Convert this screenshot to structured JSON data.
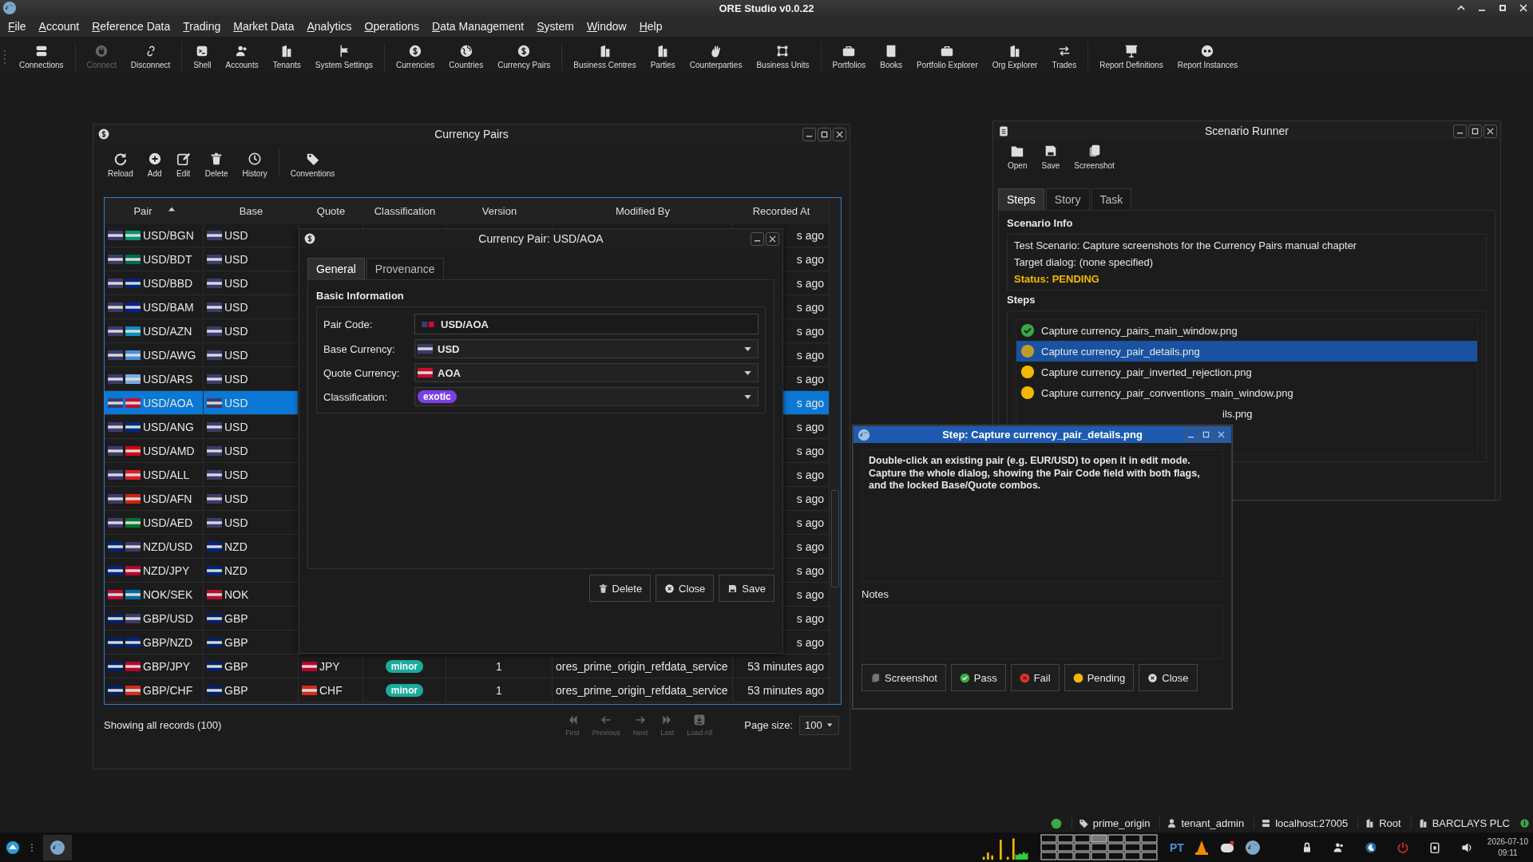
{
  "app": {
    "title": "ORE Studio v0.0.22"
  },
  "menu": [
    "File",
    "Account",
    "Reference Data",
    "Trading",
    "Market Data",
    "Analytics",
    "Operations",
    "Data Management",
    "System",
    "Window",
    "Help"
  ],
  "toolbar": [
    {
      "label": "Connections",
      "disabled": false
    },
    {
      "label": "Connect",
      "disabled": true
    },
    {
      "label": "Disconnect",
      "disabled": false
    },
    {
      "label": "Shell",
      "disabled": false
    },
    {
      "label": "Accounts",
      "disabled": false
    },
    {
      "label": "Tenants",
      "disabled": false
    },
    {
      "label": "System Settings",
      "disabled": false
    },
    {
      "label": "Currencies",
      "disabled": false
    },
    {
      "label": "Countries",
      "disabled": false
    },
    {
      "label": "Currency Pairs",
      "disabled": false
    },
    {
      "label": "Business Centres",
      "disabled": false
    },
    {
      "label": "Parties",
      "disabled": false
    },
    {
      "label": "Counterparties",
      "disabled": false
    },
    {
      "label": "Business Units",
      "disabled": false
    },
    {
      "label": "Portfolios",
      "disabled": false
    },
    {
      "label": "Books",
      "disabled": false
    },
    {
      "label": "Portfolio Explorer",
      "disabled": false
    },
    {
      "label": "Org Explorer",
      "disabled": false
    },
    {
      "label": "Trades",
      "disabled": false
    },
    {
      "label": "Report Definitions",
      "disabled": false
    },
    {
      "label": "Report Instances",
      "disabled": false
    }
  ],
  "currency_pairs": {
    "title": "Currency Pairs",
    "toolbar": [
      "Reload",
      "Add",
      "Edit",
      "Delete",
      "History",
      "Conventions"
    ],
    "columns": [
      {
        "label": "Pair",
        "sorted": true
      },
      {
        "label": "Base",
        "sorted": false
      },
      {
        "label": "Quote",
        "sorted": false
      },
      {
        "label": "Classification",
        "sorted": false
      },
      {
        "label": "Version",
        "sorted": false
      },
      {
        "label": "Modified By",
        "sorted": false
      },
      {
        "label": "Recorded At",
        "sorted": false
      }
    ],
    "rows": [
      {
        "pair": "USD/BGN",
        "pair_flags": [
          {
            "color": "#3c3b6e"
          },
          {
            "color": "#00966e"
          }
        ],
        "base": "USD",
        "base_flag": {
          "color": "#3c3b6e"
        },
        "recorded_at": "s ago",
        "selected": false
      },
      {
        "pair": "USD/BDT",
        "pair_flags": [
          {
            "color": "#3c3b6e"
          },
          {
            "color": "#006a4e"
          }
        ],
        "base": "USD",
        "base_flag": {
          "color": "#3c3b6e"
        },
        "recorded_at": "s ago",
        "selected": false
      },
      {
        "pair": "USD/BBD",
        "pair_flags": [
          {
            "color": "#3c3b6e"
          },
          {
            "color": "#00267f"
          }
        ],
        "base": "USD",
        "base_flag": {
          "color": "#3c3b6e"
        },
        "recorded_at": "s ago",
        "selected": false
      },
      {
        "pair": "USD/BAM",
        "pair_flags": [
          {
            "color": "#3c3b6e"
          },
          {
            "color": "#002395"
          }
        ],
        "base": "USD",
        "base_flag": {
          "color": "#3c3b6e"
        },
        "recorded_at": "s ago",
        "selected": false
      },
      {
        "pair": "USD/AZN",
        "pair_flags": [
          {
            "color": "#3c3b6e"
          },
          {
            "color": "#0092bc"
          }
        ],
        "base": "USD",
        "base_flag": {
          "color": "#3c3b6e"
        },
        "recorded_at": "s ago",
        "selected": false
      },
      {
        "pair": "USD/AWG",
        "pair_flags": [
          {
            "color": "#3c3b6e"
          },
          {
            "color": "#418fde"
          }
        ],
        "base": "USD",
        "base_flag": {
          "color": "#3c3b6e"
        },
        "recorded_at": "s ago",
        "selected": false
      },
      {
        "pair": "USD/ARS",
        "pair_flags": [
          {
            "color": "#3c3b6e"
          },
          {
            "color": "#74acdf"
          }
        ],
        "base": "USD",
        "base_flag": {
          "color": "#3c3b6e"
        },
        "recorded_at": "s ago",
        "selected": false
      },
      {
        "pair": "USD/AOA",
        "pair_flags": [
          {
            "color": "#3c3b6e"
          },
          {
            "color": "#cc092f"
          }
        ],
        "base": "USD",
        "base_flag": {
          "color": "#3c3b6e"
        },
        "recorded_at": "s ago",
        "selected": true
      },
      {
        "pair": "USD/ANG",
        "pair_flags": [
          {
            "color": "#3c3b6e"
          },
          {
            "color": "#002b7f"
          }
        ],
        "base": "USD",
        "base_flag": {
          "color": "#3c3b6e"
        },
        "recorded_at": "s ago",
        "selected": false
      },
      {
        "pair": "USD/AMD",
        "pair_flags": [
          {
            "color": "#3c3b6e"
          },
          {
            "color": "#d90012"
          }
        ],
        "base": "USD",
        "base_flag": {
          "color": "#3c3b6e"
        },
        "recorded_at": "s ago",
        "selected": false
      },
      {
        "pair": "USD/ALL",
        "pair_flags": [
          {
            "color": "#3c3b6e"
          },
          {
            "color": "#e41e20"
          }
        ],
        "base": "USD",
        "base_flag": {
          "color": "#3c3b6e"
        },
        "recorded_at": "s ago",
        "selected": false
      },
      {
        "pair": "USD/AFN",
        "pair_flags": [
          {
            "color": "#3c3b6e"
          },
          {
            "color": "#d32011"
          }
        ],
        "base": "USD",
        "base_flag": {
          "color": "#3c3b6e"
        },
        "recorded_at": "s ago",
        "selected": false
      },
      {
        "pair": "USD/AED",
        "pair_flags": [
          {
            "color": "#3c3b6e"
          },
          {
            "color": "#00732f"
          }
        ],
        "base": "USD",
        "base_flag": {
          "color": "#3c3b6e"
        },
        "recorded_at": "s ago",
        "selected": false
      },
      {
        "pair": "NZD/USD",
        "pair_flags": [
          {
            "color": "#00247d"
          },
          {
            "color": "#3c3b6e"
          }
        ],
        "base": "NZD",
        "base_flag": {
          "color": "#00247d"
        },
        "recorded_at": "s ago",
        "selected": false
      },
      {
        "pair": "NZD/JPY",
        "pair_flags": [
          {
            "color": "#00247d"
          },
          {
            "color": "#bc002d"
          }
        ],
        "base": "NZD",
        "base_flag": {
          "color": "#00247d"
        },
        "recorded_at": "s ago",
        "selected": false
      },
      {
        "pair": "NOK/SEK",
        "pair_flags": [
          {
            "color": "#ba0c2f"
          },
          {
            "color": "#006aa7"
          }
        ],
        "base": "NOK",
        "base_flag": {
          "color": "#ba0c2f"
        },
        "recorded_at": "s ago",
        "selected": false
      },
      {
        "pair": "GBP/USD",
        "pair_flags": [
          {
            "color": "#012169"
          },
          {
            "color": "#3c3b6e"
          }
        ],
        "base": "GBP",
        "base_flag": {
          "color": "#012169"
        },
        "recorded_at": "s ago",
        "selected": false
      },
      {
        "pair": "GBP/NZD",
        "pair_flags": [
          {
            "color": "#012169"
          },
          {
            "color": "#00247d"
          }
        ],
        "base": "GBP",
        "base_flag": {
          "color": "#012169"
        },
        "recorded_at": "s ago",
        "selected": false
      },
      {
        "pair": "GBP/JPY",
        "pair_flags": [
          {
            "color": "#012169"
          },
          {
            "color": "#bc002d"
          }
        ],
        "base": "GBP",
        "base_flag": {
          "color": "#012169"
        },
        "quote": "JPY",
        "quote_flag": {
          "color": "#bc002d"
        },
        "classification": {
          "label": "minor",
          "color": "#1aab9b"
        },
        "version": "1",
        "modified_by": "ores_prime_origin_refdata_service",
        "recorded_at": "53 minutes ago",
        "selected": false
      },
      {
        "pair": "GBP/CHF",
        "pair_flags": [
          {
            "color": "#012169"
          },
          {
            "color": "#d52b1e"
          }
        ],
        "base": "GBP",
        "base_flag": {
          "color": "#012169"
        },
        "quote": "CHF",
        "quote_flag": {
          "color": "#d52b1e"
        },
        "classification": {
          "label": "minor",
          "color": "#1aab9b"
        },
        "version": "1",
        "modified_by": "ores_prime_origin_refdata_service",
        "recorded_at": "53 minutes ago",
        "selected": false
      }
    ],
    "footer": "Showing all records (100)",
    "pager": [
      {
        "label": "First",
        "disabled": true
      },
      {
        "label": "Previous",
        "disabled": true
      },
      {
        "label": "Next",
        "disabled": true
      },
      {
        "label": "Last",
        "disabled": true
      },
      {
        "label": "Load All",
        "disabled": true
      }
    ],
    "page_size_label": "Page size:",
    "page_size": "100"
  },
  "pair_dialog": {
    "title": "Currency Pair: USD/AOA",
    "tabs": [
      {
        "label": "General",
        "selected": true
      },
      {
        "label": "Provenance",
        "selected": false
      }
    ],
    "section": "Basic Information",
    "fields": [
      {
        "label": "Pair Code:",
        "kind": "text",
        "value": "USD/AOA",
        "flags": [
          {
            "color": "#3c3b6e"
          },
          {
            "color": "#cc092f"
          }
        ]
      },
      {
        "label": "Base Currency:",
        "kind": "combo",
        "value": "USD",
        "flags": [
          {
            "color": "#3c3b6e"
          }
        ]
      },
      {
        "label": "Quote Currency:",
        "kind": "combo",
        "value": "AOA",
        "flags": [
          {
            "color": "#cc092f"
          }
        ]
      },
      {
        "label": "Classification:",
        "kind": "tag",
        "value": "exotic",
        "color": "#7b3fe4"
      }
    ],
    "buttons": [
      "Delete",
      "Close",
      "Save"
    ]
  },
  "scenario_runner": {
    "title": "Scenario Runner",
    "toolbar": [
      "Open",
      "Save",
      "Screenshot"
    ],
    "tabs": [
      {
        "label": "Steps",
        "selected": true
      },
      {
        "label": "Story",
        "selected": false
      },
      {
        "label": "Task",
        "selected": false
      }
    ],
    "info_title": "Scenario Info",
    "info": [
      "Test Scenario: Capture screenshots for the Currency Pairs manual chapter",
      "Target dialog: (none specified)"
    ],
    "status": "Status: PENDING",
    "steps_title": "Steps",
    "steps": [
      {
        "text": "Capture currency_pairs_main_window.png",
        "kind": "done",
        "selected": false,
        "cut": false
      },
      {
        "text": "Capture currency_pair_details.png",
        "kind": "pending",
        "selected": true,
        "cut": false
      },
      {
        "text": "Capture currency_pair_inverted_rejection.png",
        "kind": "pending",
        "selected": false,
        "cut": false
      },
      {
        "text": "Capture currency_pair_conventions_main_window.png",
        "kind": "pending",
        "selected": false,
        "cut": false
      },
      {
        "text": "ils.png",
        "selected": false,
        "cut": true
      }
    ]
  },
  "step_dialog": {
    "title": "Step: Capture currency_pair_details.png",
    "instructions": "Double-click an existing pair (e.g. EUR/USD) to open it in edit mode. Capture the whole dialog, showing the Pair Code field with both flags, and the locked Base/Quote combos.",
    "notes_label": "Notes",
    "buttons": [
      {
        "label": "Screenshot",
        "kind": "screenshot"
      },
      {
        "label": "Pass",
        "kind": "pass"
      },
      {
        "label": "Fail",
        "kind": "fail"
      },
      {
        "label": "Pending",
        "kind": "pending"
      },
      {
        "label": "Close",
        "kind": "close"
      }
    ]
  },
  "status_bar": {
    "connected": true,
    "items": [
      "prime_origin",
      "tenant_admin",
      "localhost:27005",
      "Root",
      "BARCLAYS PLC"
    ]
  },
  "taskbar": {
    "language": "PT",
    "date": "2026-07-10",
    "time": "09:11"
  }
}
